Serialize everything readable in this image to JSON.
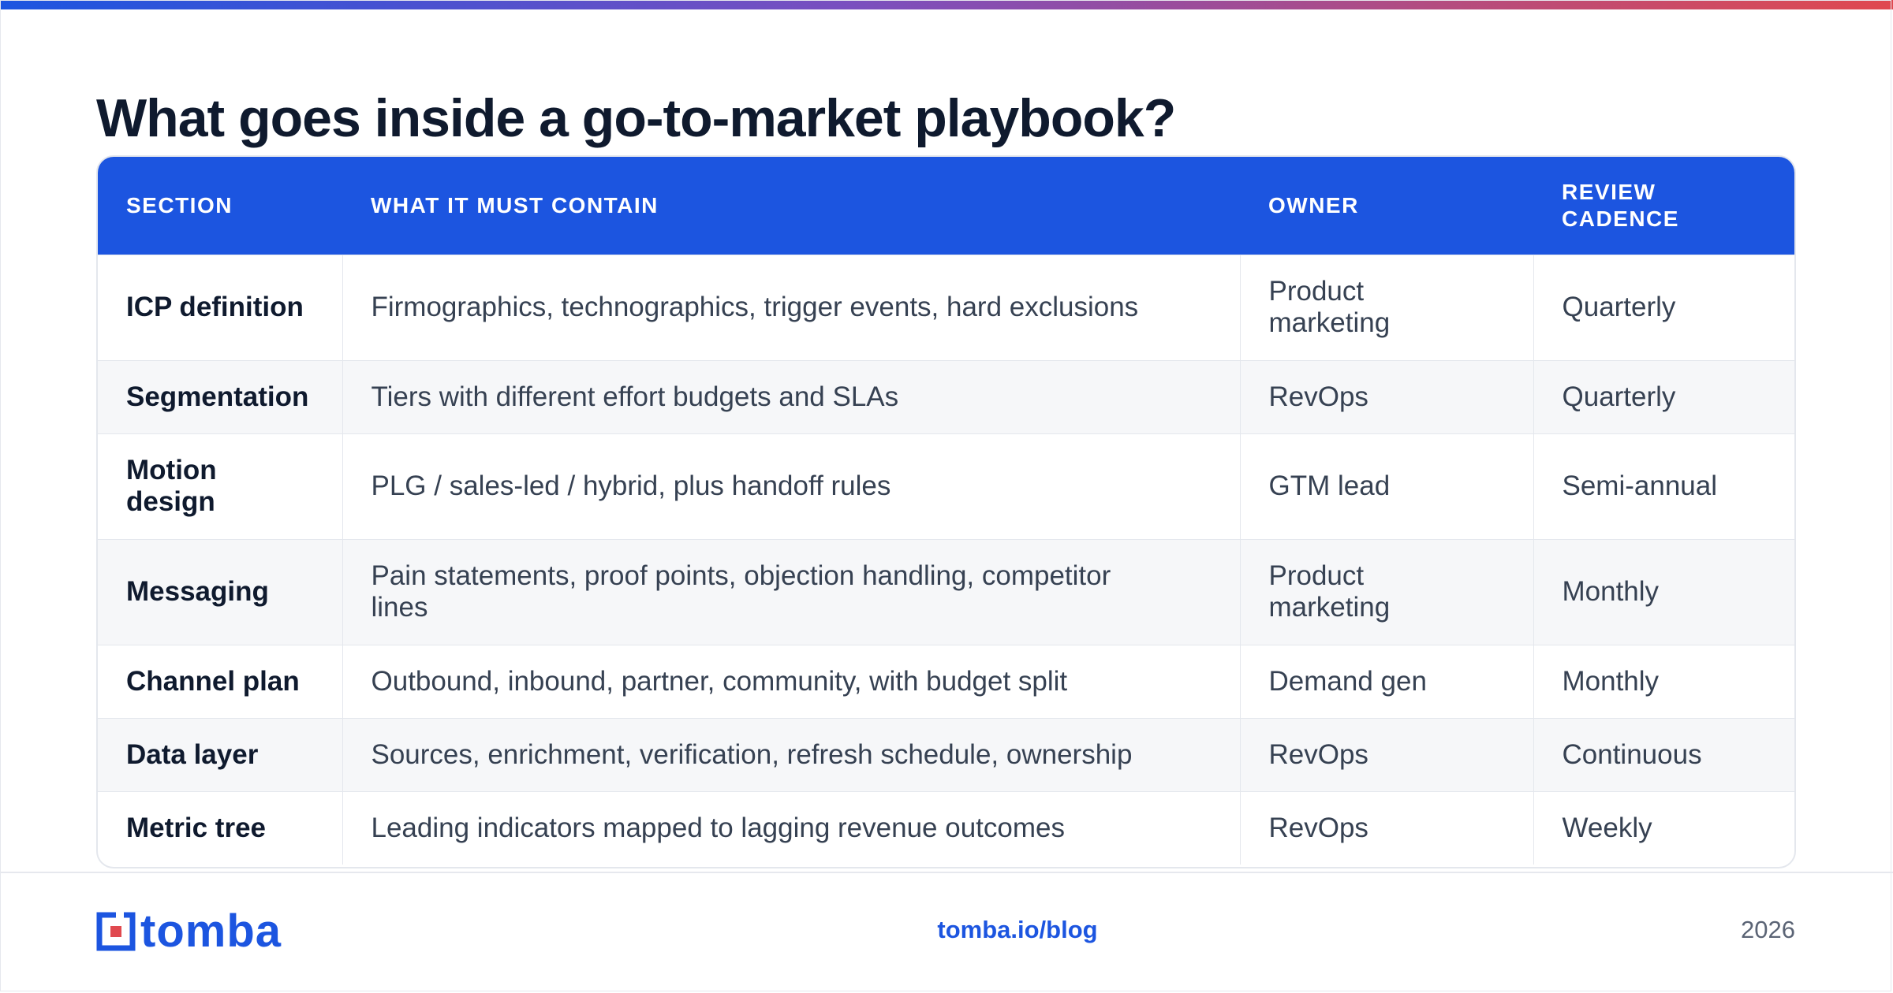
{
  "title": "What goes inside a go-to-market playbook?",
  "colors": {
    "accent": "#1c55e0",
    "title": "#0f1a2e",
    "text": "#364152",
    "gradient_end": "#e0494f"
  },
  "table": {
    "headers": [
      "SECTION",
      "WHAT IT MUST CONTAIN",
      "OWNER",
      "REVIEW CADENCE"
    ],
    "rows": [
      {
        "section": "ICP definition",
        "contents": "Firmographics, technographics, trigger events, hard exclusions",
        "owner": "Product marketing",
        "cadence": "Quarterly"
      },
      {
        "section": "Segmentation",
        "contents": "Tiers with different effort budgets and SLAs",
        "owner": "RevOps",
        "cadence": "Quarterly"
      },
      {
        "section": "Motion design",
        "contents": "PLG / sales-led / hybrid, plus handoff rules",
        "owner": "GTM lead",
        "cadence": "Semi-annual"
      },
      {
        "section": "Messaging",
        "contents": "Pain statements, proof points, objection handling, competitor lines",
        "owner": "Product marketing",
        "cadence": "Monthly"
      },
      {
        "section": "Channel plan",
        "contents": "Outbound, inbound, partner, community, with budget split",
        "owner": "Demand gen",
        "cadence": "Monthly"
      },
      {
        "section": "Data layer",
        "contents": "Sources, enrichment, verification, refresh schedule, ownership",
        "owner": "RevOps",
        "cadence": "Continuous"
      },
      {
        "section": "Metric tree",
        "contents": "Leading indicators mapped to lagging revenue outcomes",
        "owner": "RevOps",
        "cadence": "Weekly"
      }
    ]
  },
  "footer": {
    "logo_text": "tomba",
    "logo_icon": "tomba-logo-icon",
    "link": "tomba.io/blog",
    "year": "2026"
  }
}
